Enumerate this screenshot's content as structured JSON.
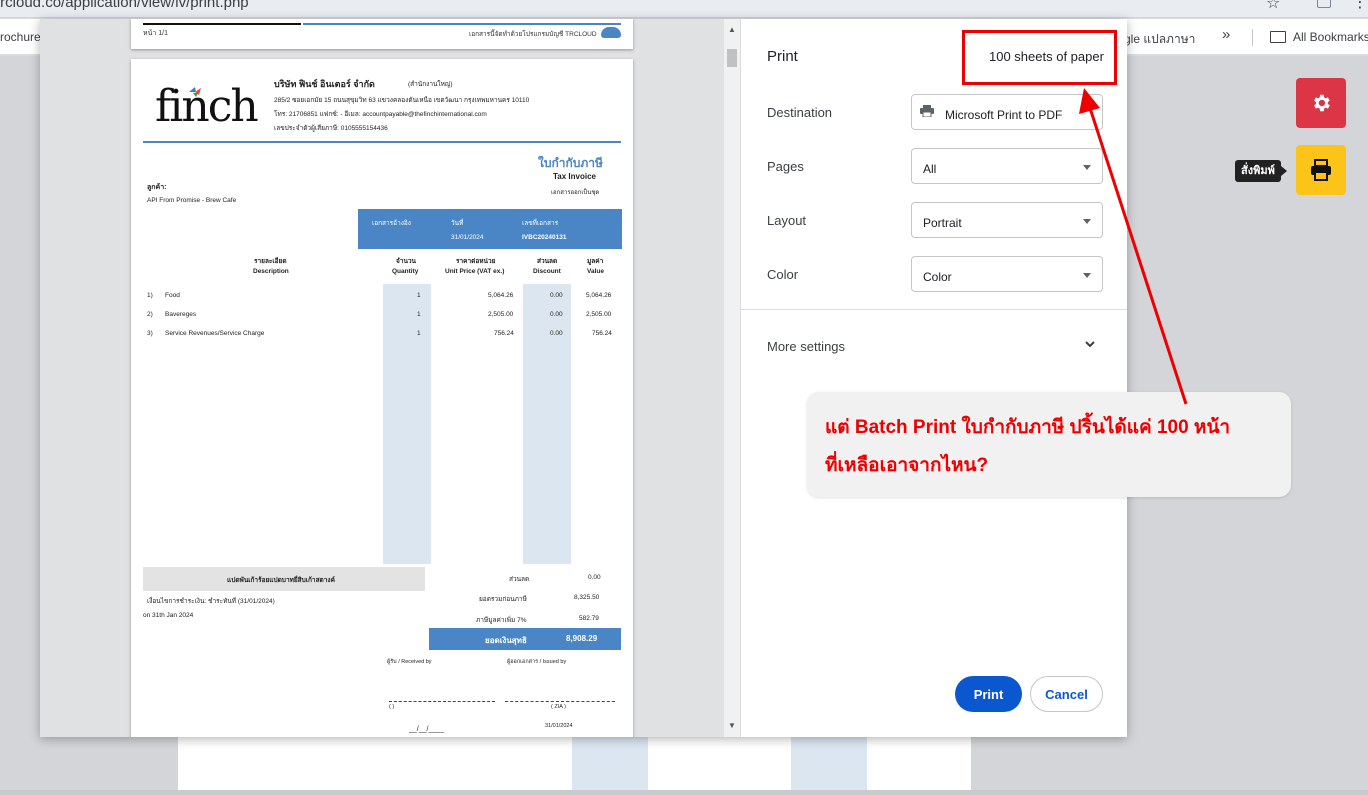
{
  "browser": {
    "url": "trcloud.co/application/view/iv/print.php",
    "bookmarks": {
      "left_item": "rochure:",
      "translate_item": "gle แปลภาษา",
      "overflow": "»",
      "all_bookmarks": "All Bookmarks"
    }
  },
  "side_buttons": {
    "print_tooltip": "สั่งพิมพ์"
  },
  "preview": {
    "page1": {
      "page_number": "หน้า 1/1",
      "footer": "เอกสารนี้จัดทำด้วยโปรแกรมบัญชี TRCLOUD"
    },
    "invoice": {
      "logo_text": "finch",
      "company_name": "บริษัท ฟินช์ อินเตอร์ จำกัด",
      "company_branch": "(สำนักงานใหญ่)",
      "address": "285/2 ซอยเอกมัย 15 ถนนสุขุมวิท 63 แขวงคลองตันเหนือ เขตวัฒนา กรุงเทพมหานคร 10110",
      "contact": "โทร: 21706851 แฟกซ์: - อีเมล: accountpayable@thefinchinternational.com",
      "tax_id": "เลขประจำตัวผู้เสียภาษี: 0105555154436",
      "doc_title_th": "ใบกำกับภาษี",
      "doc_title_en": "Tax Invoice",
      "doc_subtitle": "เอกสารออกเป็นชุด",
      "customer_label": "ลูกค้า:",
      "customer_name": "API From Promise - Brew Cafe",
      "ref_label": "เอกสารอ้างอิง",
      "date_label": "วันที่",
      "date_value": "31/01/2024",
      "docno_label": "เลขที่เอกสาร",
      "docno_value": "IVBC20240131",
      "headers": {
        "desc_th": "รายละเอียด",
        "desc_en": "Description",
        "qty_th": "จำนวน",
        "qty_en": "Quantity",
        "price_th": "ราคาต่อหน่วย",
        "price_en": "Unit Price (VAT ex.)",
        "disc_th": "ส่วนลด",
        "disc_en": "Discount",
        "val_th": "มูลค่า",
        "val_en": "Value"
      },
      "items": [
        {
          "no": "1)",
          "desc": "Food",
          "qty": "1",
          "price": "5,064.26",
          "disc": "0.00",
          "value": "5,064.26"
        },
        {
          "no": "2)",
          "desc": "Bavereges",
          "qty": "1",
          "price": "2,505.00",
          "disc": "0.00",
          "value": "2,505.00"
        },
        {
          "no": "3)",
          "desc": "Service Revenues/Service Charge",
          "qty": "1",
          "price": "756.24",
          "disc": "0.00",
          "value": "756.24"
        }
      ],
      "amount_words": "แปดพันเก้าร้อยแปดบาทยี่สิบเก้าสตางค์",
      "payment_note": "เงื่อนไขการชำระเงิน: ชำระทันที (31/01/2024)",
      "date_note": "on 31th Jan 2024",
      "discount_label": "ส่วนลด",
      "discount_value": "0.00",
      "subtotal_label": "ยอดรวมก่อนภาษี",
      "subtotal_value": "8,325.50",
      "vat_label": "ภาษีมูลค่าเพิ่ม 7%",
      "vat_value": "582.79",
      "net_label": "ยอดเงินสุทธิ",
      "net_value": "8,908.29",
      "received_by": "ผู้รับ / Received by",
      "issued_by": "ผู้ออกเอกสาร / Issued by",
      "sig_paren": "(                                          )",
      "issuer_name": "( ZIA )",
      "date_blank": "__/__/____",
      "issue_date": "31/01/2024"
    }
  },
  "print_dialog": {
    "title": "Print",
    "sheets": "100 sheets of paper",
    "destination_label": "Destination",
    "destination_value": "Microsoft Print to PDF",
    "pages_label": "Pages",
    "pages_value": "All",
    "layout_label": "Layout",
    "layout_value": "Portrait",
    "color_label": "Color",
    "color_value": "Color",
    "more_settings": "More settings",
    "print_button": "Print",
    "cancel_button": "Cancel"
  },
  "callout": {
    "line1": "แต่ Batch Print ใบกำกับภาษี ปริ้นได้แค่ 100 หน้า",
    "line2": "ที่เหลือเอาจากไหน?"
  },
  "colors": {
    "accent_blue": "#0b57d0",
    "annotation_red": "#e00000",
    "invoice_blue": "#4a86c5",
    "gear_button": "#dc3545",
    "print_button": "#fcc419"
  }
}
